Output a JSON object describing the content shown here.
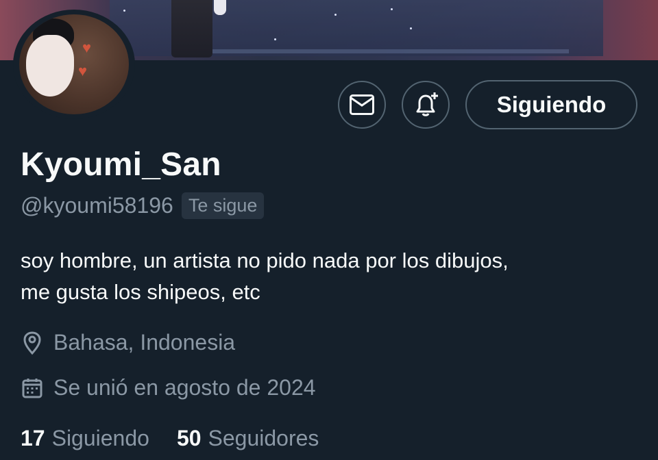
{
  "profile": {
    "display_name": "Kyoumi_San",
    "handle": "@kyoumi58196",
    "follows_you_badge": "Te sigue",
    "bio_line1": "soy hombre, un artista no pido nada por los dibujos,",
    "bio_line2": "me gusta los shipeos, etc",
    "location": "Bahasa, Indonesia",
    "joined": "Se unió en agosto de 2024"
  },
  "actions": {
    "message_icon": "envelope-icon",
    "notify_icon": "bell-plus-icon",
    "follow_state_label": "Siguiendo"
  },
  "stats": {
    "following_count": "17",
    "following_label": "Siguiendo",
    "followers_count": "50",
    "followers_label": "Seguidores"
  },
  "colors": {
    "background": "#15202b",
    "text_primary": "#f7f9f9",
    "text_secondary": "#8b98a5",
    "border": "#536471",
    "badge_bg": "#273340"
  }
}
